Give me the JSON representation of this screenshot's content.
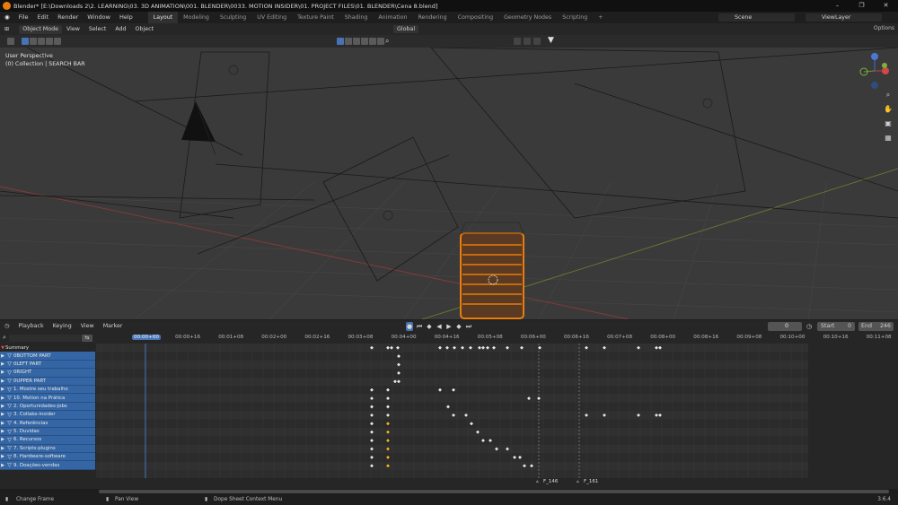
{
  "window": {
    "title": "Blender* [E:\\Downloads 2\\2. LEARNING\\03. 3D ANIMATION\\001. BLENDER\\0033. MOTION INSIDER\\01. PROJECT FILES\\01. BLENDER\\Cena 8.blend]",
    "minimize": "–",
    "maximize": "❐",
    "close": "✕"
  },
  "menu": [
    "File",
    "Edit",
    "Render",
    "Window",
    "Help"
  ],
  "workspaces": [
    {
      "label": "Layout",
      "active": true
    },
    {
      "label": "Modeling",
      "active": false
    },
    {
      "label": "Sculpting",
      "active": false
    },
    {
      "label": "UV Editing",
      "active": false
    },
    {
      "label": "Texture Paint",
      "active": false
    },
    {
      "label": "Shading",
      "active": false
    },
    {
      "label": "Animation",
      "active": false
    },
    {
      "label": "Rendering",
      "active": false
    },
    {
      "label": "Compositing",
      "active": false
    },
    {
      "label": "Geometry Nodes",
      "active": false
    },
    {
      "label": "Scripting",
      "active": false
    }
  ],
  "add_workspace": "+",
  "scene": {
    "label": "Scene"
  },
  "view_layer": {
    "label": "ViewLayer"
  },
  "viewport_header": {
    "mode": "Object Mode",
    "menus": [
      "View",
      "Select",
      "Add",
      "Object"
    ],
    "orientation": "Global",
    "options": "Options"
  },
  "viewport": {
    "perspective": "User Perspective",
    "collection": "(0) Collection | SEARCH BAR"
  },
  "dope_header": {
    "menus": [
      "Playback",
      "Keying",
      "View",
      "Marker"
    ],
    "current_frame": "0",
    "start_label": "Start",
    "start_value": "0",
    "end_label": "End",
    "end_value": "246"
  },
  "channels": [
    {
      "label": "Summary",
      "type": "summary"
    },
    {
      "label": "0BOTTOM PART",
      "type": "obj"
    },
    {
      "label": "0LEFT PART",
      "type": "obj"
    },
    {
      "label": "0RIGHT",
      "type": "obj"
    },
    {
      "label": "0UPPER PART",
      "type": "obj"
    },
    {
      "label": "1. Mostre seu trabalho",
      "type": "obj"
    },
    {
      "label": "10. Motion na Prática",
      "type": "obj"
    },
    {
      "label": "2. Oportunidades-jobs",
      "type": "obj"
    },
    {
      "label": "3. Collabs-insider",
      "type": "obj"
    },
    {
      "label": "4. Referências",
      "type": "obj"
    },
    {
      "label": "5. Duvidas",
      "type": "obj"
    },
    {
      "label": "6. Recursos",
      "type": "obj"
    },
    {
      "label": "7. Scripts-plugins",
      "type": "obj"
    },
    {
      "label": "8. Hardware-software",
      "type": "obj"
    },
    {
      "label": "9. Doações-vendas",
      "type": "obj"
    }
  ],
  "timeline_labels": [
    "00:00+00",
    "00:00+16",
    "00:01+08",
    "00:02+00",
    "00:02+16",
    "00:03+08",
    "00:04+00",
    "00:04+16",
    "00:05+08",
    "00:06+00",
    "00:06+16",
    "00:07+08",
    "00:08+00",
    "00:08+16",
    "00:09+08",
    "00:10+00",
    "00:10+16",
    "00:11+08"
  ],
  "markers": [
    {
      "label": "F_146"
    },
    {
      "label": "F_161"
    }
  ],
  "status": {
    "change_frame": "Change Frame",
    "pan_view": "Pan View",
    "context_menu": "Dope Sheet Context Menu",
    "version": "3.6.4"
  },
  "icons": {
    "blender_logo": "blender-logo-icon",
    "search": "search-icon",
    "playhead": "playhead-icon"
  },
  "colors": {
    "accent": "#4772b3",
    "channel": "#3466a6",
    "selection_outline": "#e87d0d",
    "keyframe": "#e6e6e6",
    "keyframe_selected": "#f0b030"
  }
}
